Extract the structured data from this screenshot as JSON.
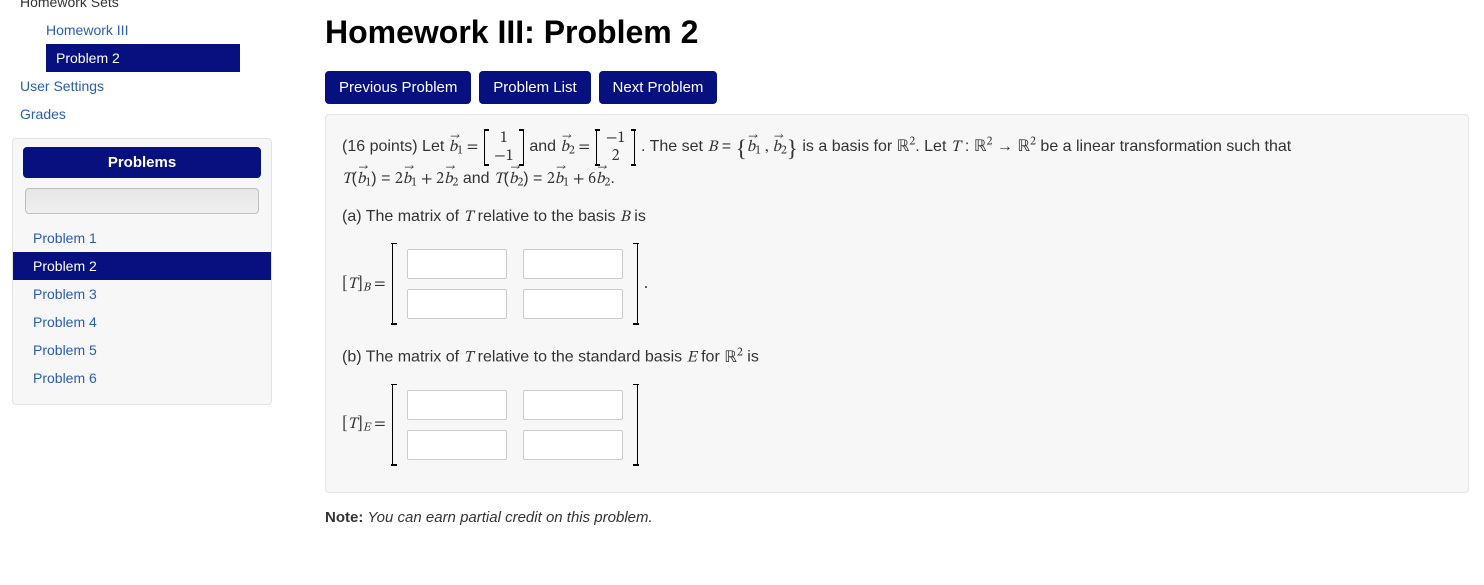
{
  "sidebar": {
    "nav": {
      "homework_sets": "Homework Sets",
      "homework_iii": "Homework III",
      "problem_2": "Problem 2",
      "user_settings": "User Settings",
      "grades": "Grades"
    },
    "panel": {
      "title": "Problems",
      "problems": [
        "Problem 1",
        "Problem 2",
        "Problem 3",
        "Problem 4",
        "Problem 5",
        "Problem 6"
      ],
      "active_index": 1
    }
  },
  "main": {
    "title": "Homework III: Problem 2",
    "buttons": {
      "prev": "Previous Problem",
      "list": "Problem List",
      "next": "Next Problem"
    },
    "problem": {
      "points_label": "(16 points)",
      "points_value": 16,
      "b1": [
        1,
        -1
      ],
      "b2": [
        -1,
        2
      ],
      "T_b1_coeffs": [
        2,
        2
      ],
      "T_b2_coeffs": [
        2,
        6
      ],
      "part_a_text": "(a) The matrix of T relative to the basis B is",
      "label_TB": "[T]",
      "sub_B": "B",
      "part_b_text": "(b) The matrix of T relative to the standard basis E for ℝ² is",
      "label_TE": "[T]",
      "sub_E": "E",
      "period": "."
    },
    "note_bold": "Note:",
    "note_text": "You can earn partial credit on this problem."
  }
}
